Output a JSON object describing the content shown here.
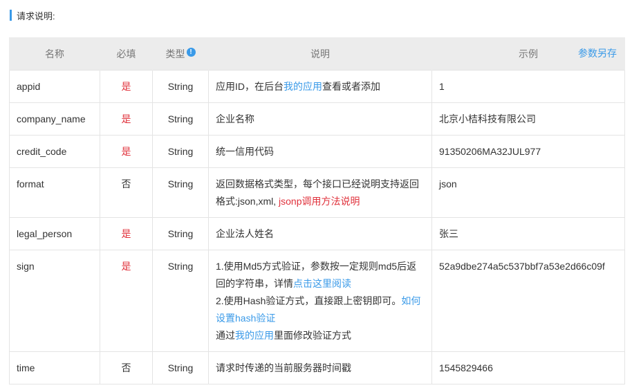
{
  "section_title": "请求说明:",
  "table": {
    "headers": {
      "name": "名称",
      "required": "必填",
      "type": "类型",
      "type_info_icon": "!",
      "description": "说明",
      "example": "示例",
      "save_params": "参数另存"
    },
    "rows": [
      {
        "name": "appid",
        "required": "是",
        "type": "String",
        "description": {
          "before": "应用ID，在后台",
          "link": "我的应用",
          "after": "查看或者添加"
        },
        "example": "1"
      },
      {
        "name": "company_name",
        "required": "是",
        "type": "String",
        "description": "企业名称",
        "example": "北京小桔科技有限公司"
      },
      {
        "name": "credit_code",
        "required": "是",
        "type": "String",
        "description": "统一信用代码",
        "example": "91350206MA32JUL977"
      },
      {
        "name": "format",
        "required": "否",
        "type": "String",
        "description": {
          "line1": "返回数据格式类型，每个接口已经说明支持返回",
          "line2_before": "格式:json,xml, ",
          "link": "jsonp调用方法说明"
        },
        "example": "json"
      },
      {
        "name": "legal_person",
        "required": "是",
        "type": "String",
        "description": "企业法人姓名",
        "example": "张三"
      },
      {
        "name": "sign",
        "required": "是",
        "type": "String",
        "description": {
          "part1_line1": "1.使用Md5方式验证，参数按一定规则md5后返",
          "part1_line2_before": "回的字符串，详情",
          "part1_link": "点击这里阅读",
          "part2_before": "2.使用Hash验证方式，直接跟上密钥即可。",
          "part2_link_line1": "如何",
          "part2_link_line2": "设置hash验证",
          "part3_before": "通过",
          "part3_link": "我的应用",
          "part3_after": "里面修改验证方式"
        },
        "example": "52a9dbe274a5c537bbf7a53e2d66c09f"
      },
      {
        "name": "time",
        "required": "否",
        "type": "String",
        "description": "请求时传递的当前服务器时间戳",
        "example": "1545829466"
      }
    ]
  },
  "colors": {
    "accent": "#3a9ae8",
    "required_yes": "#e0313b",
    "header_bg": "#ececec"
  }
}
